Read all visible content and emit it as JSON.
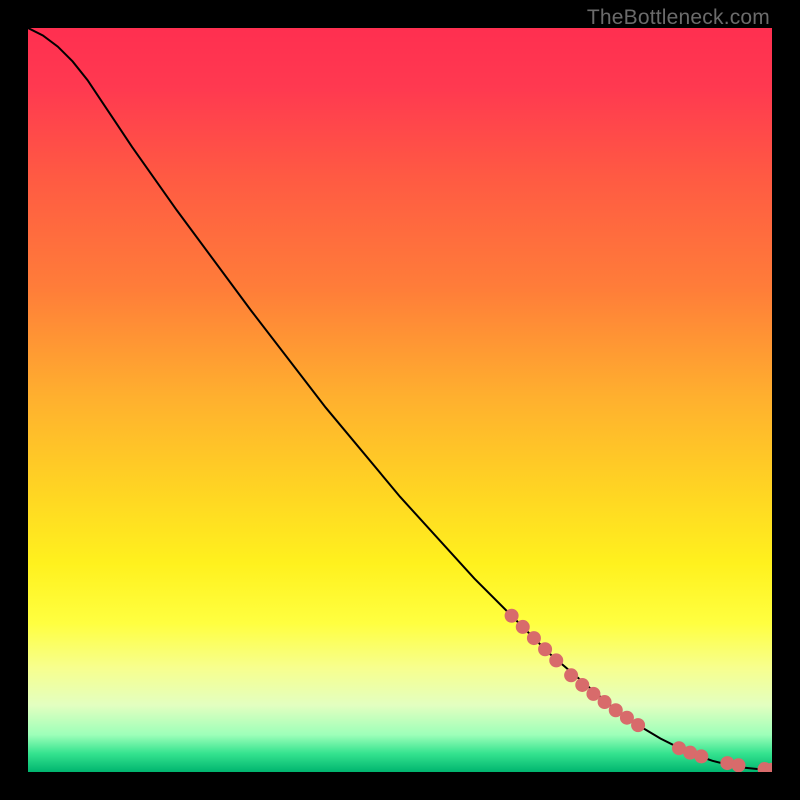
{
  "watermark": "TheBottleneck.com",
  "chart_data": {
    "type": "line",
    "title": "",
    "xlabel": "",
    "ylabel": "",
    "xlim": [
      0,
      100
    ],
    "ylim": [
      0,
      100
    ],
    "background_gradient_stops": [
      {
        "pos": 0.0,
        "color": "#ff2f50"
      },
      {
        "pos": 0.08,
        "color": "#ff3950"
      },
      {
        "pos": 0.2,
        "color": "#ff5a43"
      },
      {
        "pos": 0.35,
        "color": "#ff7d39"
      },
      {
        "pos": 0.5,
        "color": "#ffb12e"
      },
      {
        "pos": 0.62,
        "color": "#ffd423"
      },
      {
        "pos": 0.72,
        "color": "#fff11e"
      },
      {
        "pos": 0.8,
        "color": "#ffff40"
      },
      {
        "pos": 0.86,
        "color": "#f7ff8e"
      },
      {
        "pos": 0.91,
        "color": "#e3ffc0"
      },
      {
        "pos": 0.95,
        "color": "#9dffb9"
      },
      {
        "pos": 0.975,
        "color": "#35e38f"
      },
      {
        "pos": 1.0,
        "color": "#00b56f"
      }
    ],
    "series": [
      {
        "name": "curve",
        "color": "#000000",
        "stroke_width": 2,
        "x": [
          0,
          2,
          4,
          6,
          8,
          10,
          12,
          14,
          20,
          30,
          40,
          50,
          60,
          70,
          80,
          85,
          88,
          90,
          92,
          94,
          96,
          98,
          100
        ],
        "y": [
          100,
          99.0,
          97.5,
          95.5,
          93.0,
          90.0,
          87.0,
          84.0,
          75.5,
          62.0,
          49.0,
          37.0,
          26.0,
          16.0,
          7.5,
          4.5,
          3.0,
          2.2,
          1.5,
          1.0,
          0.6,
          0.4,
          0.3
        ]
      }
    ],
    "markers": {
      "name": "highlighted-points",
      "color": "#d86b6b",
      "radius": 7,
      "points": [
        {
          "x": 65.0,
          "y": 21.0
        },
        {
          "x": 66.5,
          "y": 19.5
        },
        {
          "x": 68.0,
          "y": 18.0
        },
        {
          "x": 69.5,
          "y": 16.5
        },
        {
          "x": 71.0,
          "y": 15.0
        },
        {
          "x": 73.0,
          "y": 13.0
        },
        {
          "x": 74.5,
          "y": 11.7
        },
        {
          "x": 76.0,
          "y": 10.5
        },
        {
          "x": 77.5,
          "y": 9.4
        },
        {
          "x": 79.0,
          "y": 8.3
        },
        {
          "x": 80.5,
          "y": 7.3
        },
        {
          "x": 82.0,
          "y": 6.3
        },
        {
          "x": 87.5,
          "y": 3.2
        },
        {
          "x": 89.0,
          "y": 2.6
        },
        {
          "x": 90.5,
          "y": 2.1
        },
        {
          "x": 94.0,
          "y": 1.2
        },
        {
          "x": 95.5,
          "y": 0.9
        },
        {
          "x": 99.0,
          "y": 0.4
        },
        {
          "x": 100.0,
          "y": 0.3
        }
      ]
    }
  }
}
